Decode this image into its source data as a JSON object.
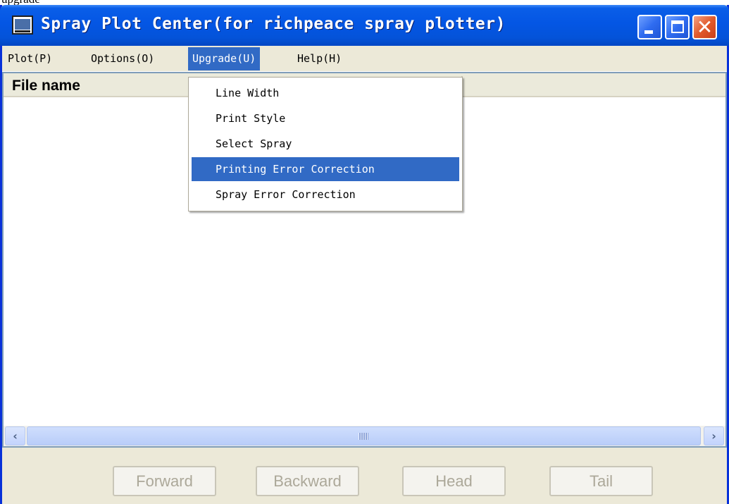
{
  "top_fragment": "upgrade",
  "window": {
    "title": "Spray Plot Center(for richpeace spray plotter)"
  },
  "menubar": {
    "items": [
      {
        "label": "Plot(P)"
      },
      {
        "label": "Options(O)"
      },
      {
        "label": "Upgrade(U)"
      },
      {
        "label": "Help(H)"
      }
    ]
  },
  "upgrade_menu": {
    "items": [
      {
        "label": "Line Width"
      },
      {
        "label": "Print Style"
      },
      {
        "label": "Select Spray"
      },
      {
        "label": "Printing Error Correction"
      },
      {
        "label": "Spray Error Correction"
      }
    ],
    "highlighted": "Printing Error Correction"
  },
  "list": {
    "columns": [
      {
        "label": "File name"
      }
    ]
  },
  "buttons": {
    "forward": "Forward",
    "backward": "Backward",
    "head": "Head",
    "tail": "Tail"
  },
  "icons": {
    "app": "plotter-icon",
    "minimize": "minimize-icon",
    "maximize": "maximize-icon",
    "close": "close-icon",
    "scroll_left": "arrow-left-icon",
    "scroll_right": "arrow-right-icon"
  },
  "colors": {
    "titlebar": "#0456e4",
    "menu_highlight": "#316ac5",
    "window_face": "#ece9d8",
    "disabled_text": "#aca899"
  }
}
